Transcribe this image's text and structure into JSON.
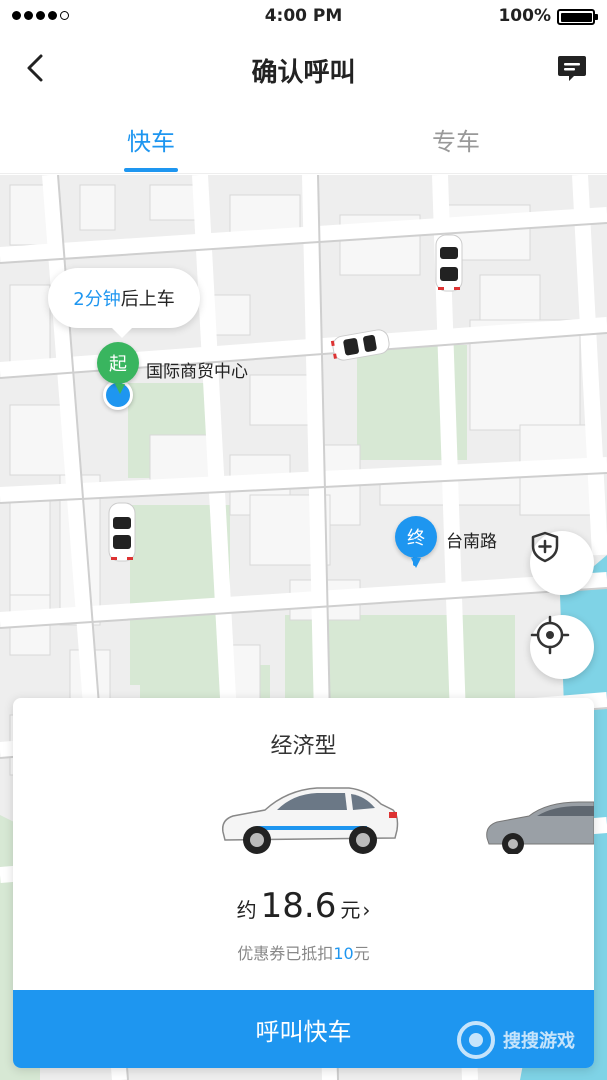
{
  "status_bar": {
    "time": "4:00 PM",
    "battery": "100%"
  },
  "nav": {
    "title": "确认呼叫"
  },
  "tabs": [
    {
      "label": "快车",
      "active": true
    },
    {
      "label": "专车",
      "active": false
    }
  ],
  "map": {
    "eta_value": "2分钟",
    "eta_suffix": "后上车",
    "start_marker": "起",
    "start_label": "国际商贸中心",
    "end_marker": "终",
    "end_label": "台南路"
  },
  "card": {
    "car_type": "经济型",
    "price_prefix": "约",
    "price_value": "18.6",
    "price_unit": "元",
    "price_chevron": "›",
    "discount_prefix": "优惠券已抵扣",
    "discount_amount": "10",
    "discount_suffix": "元",
    "call_button": "呼叫快车"
  },
  "watermark": {
    "text": "搜搜游戏"
  },
  "colors": {
    "accent": "#1e96f0",
    "start_green": "#39b55f"
  }
}
